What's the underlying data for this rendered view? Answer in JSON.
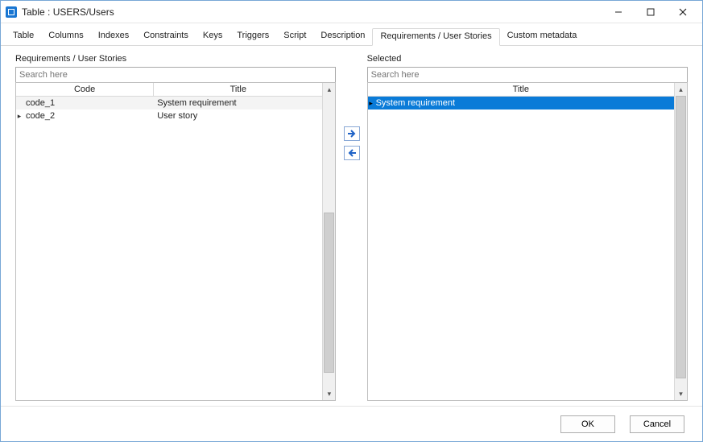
{
  "window": {
    "title": "Table : USERS/Users"
  },
  "tabs": [
    {
      "id": "table",
      "label": "Table"
    },
    {
      "id": "columns",
      "label": "Columns"
    },
    {
      "id": "indexes",
      "label": "Indexes"
    },
    {
      "id": "constraints",
      "label": "Constraints"
    },
    {
      "id": "keys",
      "label": "Keys"
    },
    {
      "id": "triggers",
      "label": "Triggers"
    },
    {
      "id": "script",
      "label": "Script"
    },
    {
      "id": "description",
      "label": "Description"
    },
    {
      "id": "req",
      "label": "Requirements / User Stories",
      "active": true
    },
    {
      "id": "meta",
      "label": "Custom metadata"
    }
  ],
  "left": {
    "heading": "Requirements / User Stories",
    "search_placeholder": "Search here",
    "columns": {
      "code": "Code",
      "title": "Title"
    },
    "rows": [
      {
        "code": "code_1",
        "title": "System requirement",
        "current": false
      },
      {
        "code": "code_2",
        "title": "User story",
        "current": true
      }
    ]
  },
  "right": {
    "heading": "Selected",
    "search_placeholder": "Search here",
    "columns": {
      "title": "Title"
    },
    "rows": [
      {
        "title": "System requirement",
        "selected": true,
        "current": true
      }
    ]
  },
  "footer": {
    "ok": "OK",
    "cancel": "Cancel"
  }
}
